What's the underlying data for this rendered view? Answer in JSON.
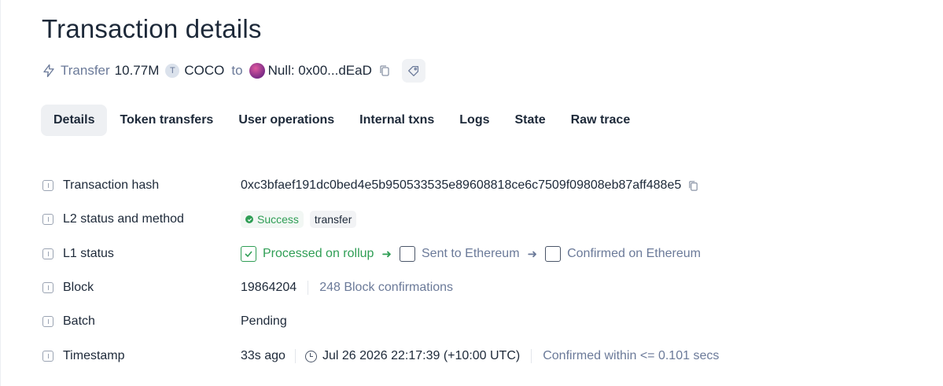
{
  "page": {
    "title": "Transaction details"
  },
  "summary": {
    "action": "Transfer",
    "amount": "10.77M",
    "token_icon_letter": "T",
    "token": "COCO",
    "to_word": "to",
    "recipient": "Null: 0x00...dEaD"
  },
  "tabs": [
    {
      "label": "Details",
      "active": true
    },
    {
      "label": "Token transfers"
    },
    {
      "label": "User operations"
    },
    {
      "label": "Internal txns"
    },
    {
      "label": "Logs"
    },
    {
      "label": "State"
    },
    {
      "label": "Raw trace"
    }
  ],
  "details": {
    "hash": {
      "label": "Transaction hash",
      "value": "0xc3bfaef191dc0bed4e5b950533535e89608818ce6c7509f09808eb87aff488e5"
    },
    "l2_status": {
      "label": "L2 status and method",
      "status": "Success",
      "method": "transfer"
    },
    "l1_status": {
      "label": "L1 status",
      "steps": [
        "Processed on rollup",
        "Sent to Ethereum",
        "Confirmed on Ethereum"
      ]
    },
    "block": {
      "label": "Block",
      "number": "19864204",
      "confirmations": "248 Block confirmations"
    },
    "batch": {
      "label": "Batch",
      "value": "Pending"
    },
    "timestamp": {
      "label": "Timestamp",
      "relative": "33s ago",
      "absolute": "Jul 26 2026 22:17:39 (+10:00 UTC)",
      "confirmed": "Confirmed within <= 0.101 secs"
    }
  },
  "colors": {
    "success": "#2f9e55",
    "muted": "#6b7a99",
    "text": "#1d2939"
  }
}
